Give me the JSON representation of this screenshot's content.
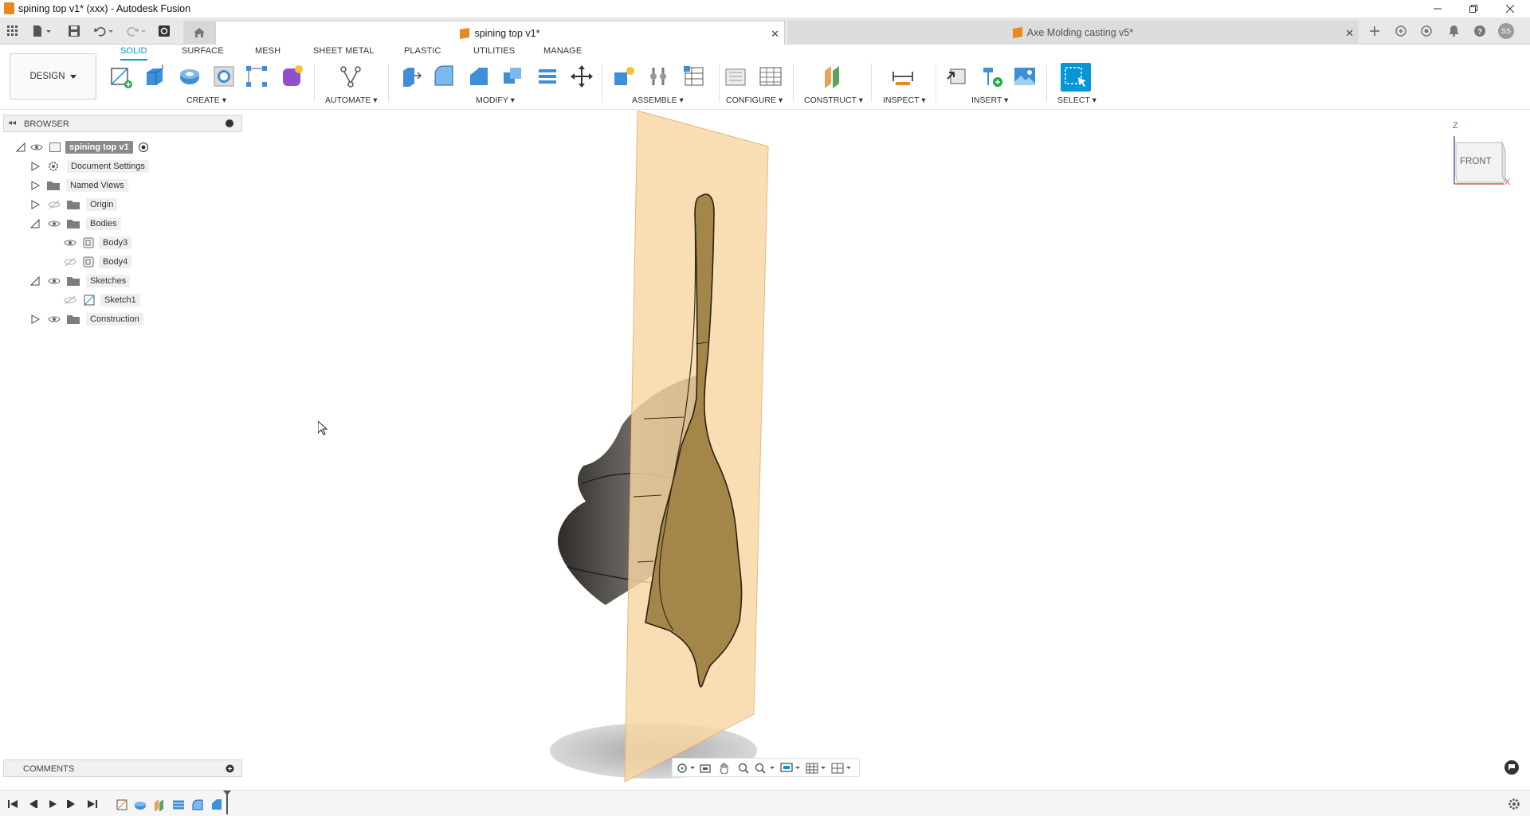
{
  "window": {
    "title": "spining top v1* (xxx) - Autodesk Fusion"
  },
  "tabs": {
    "active": "spining top v1*",
    "inactive": "Axe Molding casting v5*"
  },
  "workspace": {
    "design_label": "DESIGN",
    "tabs": [
      "SOLID",
      "SURFACE",
      "MESH",
      "SHEET METAL",
      "PLASTIC",
      "UTILITIES",
      "MANAGE"
    ],
    "active_tab": "SOLID",
    "groups": [
      "CREATE",
      "AUTOMATE",
      "MODIFY",
      "ASSEMBLE",
      "CONFIGURE",
      "CONSTRUCT",
      "INSPECT",
      "INSERT",
      "SELECT"
    ]
  },
  "browser": {
    "title": "BROWSER",
    "root": "spining top v1",
    "items": [
      {
        "label": "Document Settings",
        "icon": "gear-icon"
      },
      {
        "label": "Named Views",
        "icon": "folder-icon"
      },
      {
        "label": "Origin",
        "icon": "folder-icon"
      },
      {
        "label": "Bodies",
        "icon": "folder-icon"
      },
      {
        "label": "Body3",
        "icon": "body-icon"
      },
      {
        "label": "Body4",
        "icon": "body-icon"
      },
      {
        "label": "Sketches",
        "icon": "folder-icon"
      },
      {
        "label": "Sketch1",
        "icon": "sketch-icon"
      },
      {
        "label": "Construction",
        "icon": "folder-icon"
      }
    ]
  },
  "comments": {
    "title": "COMMENTS"
  },
  "viewcube": {
    "face": "FRONT",
    "axis_z": "Z",
    "axis_x": "X"
  },
  "colors": {
    "accent": "#0696d7",
    "plane": "#f8d7a3",
    "body": "#9a7a40",
    "brand": "#e8891f"
  }
}
